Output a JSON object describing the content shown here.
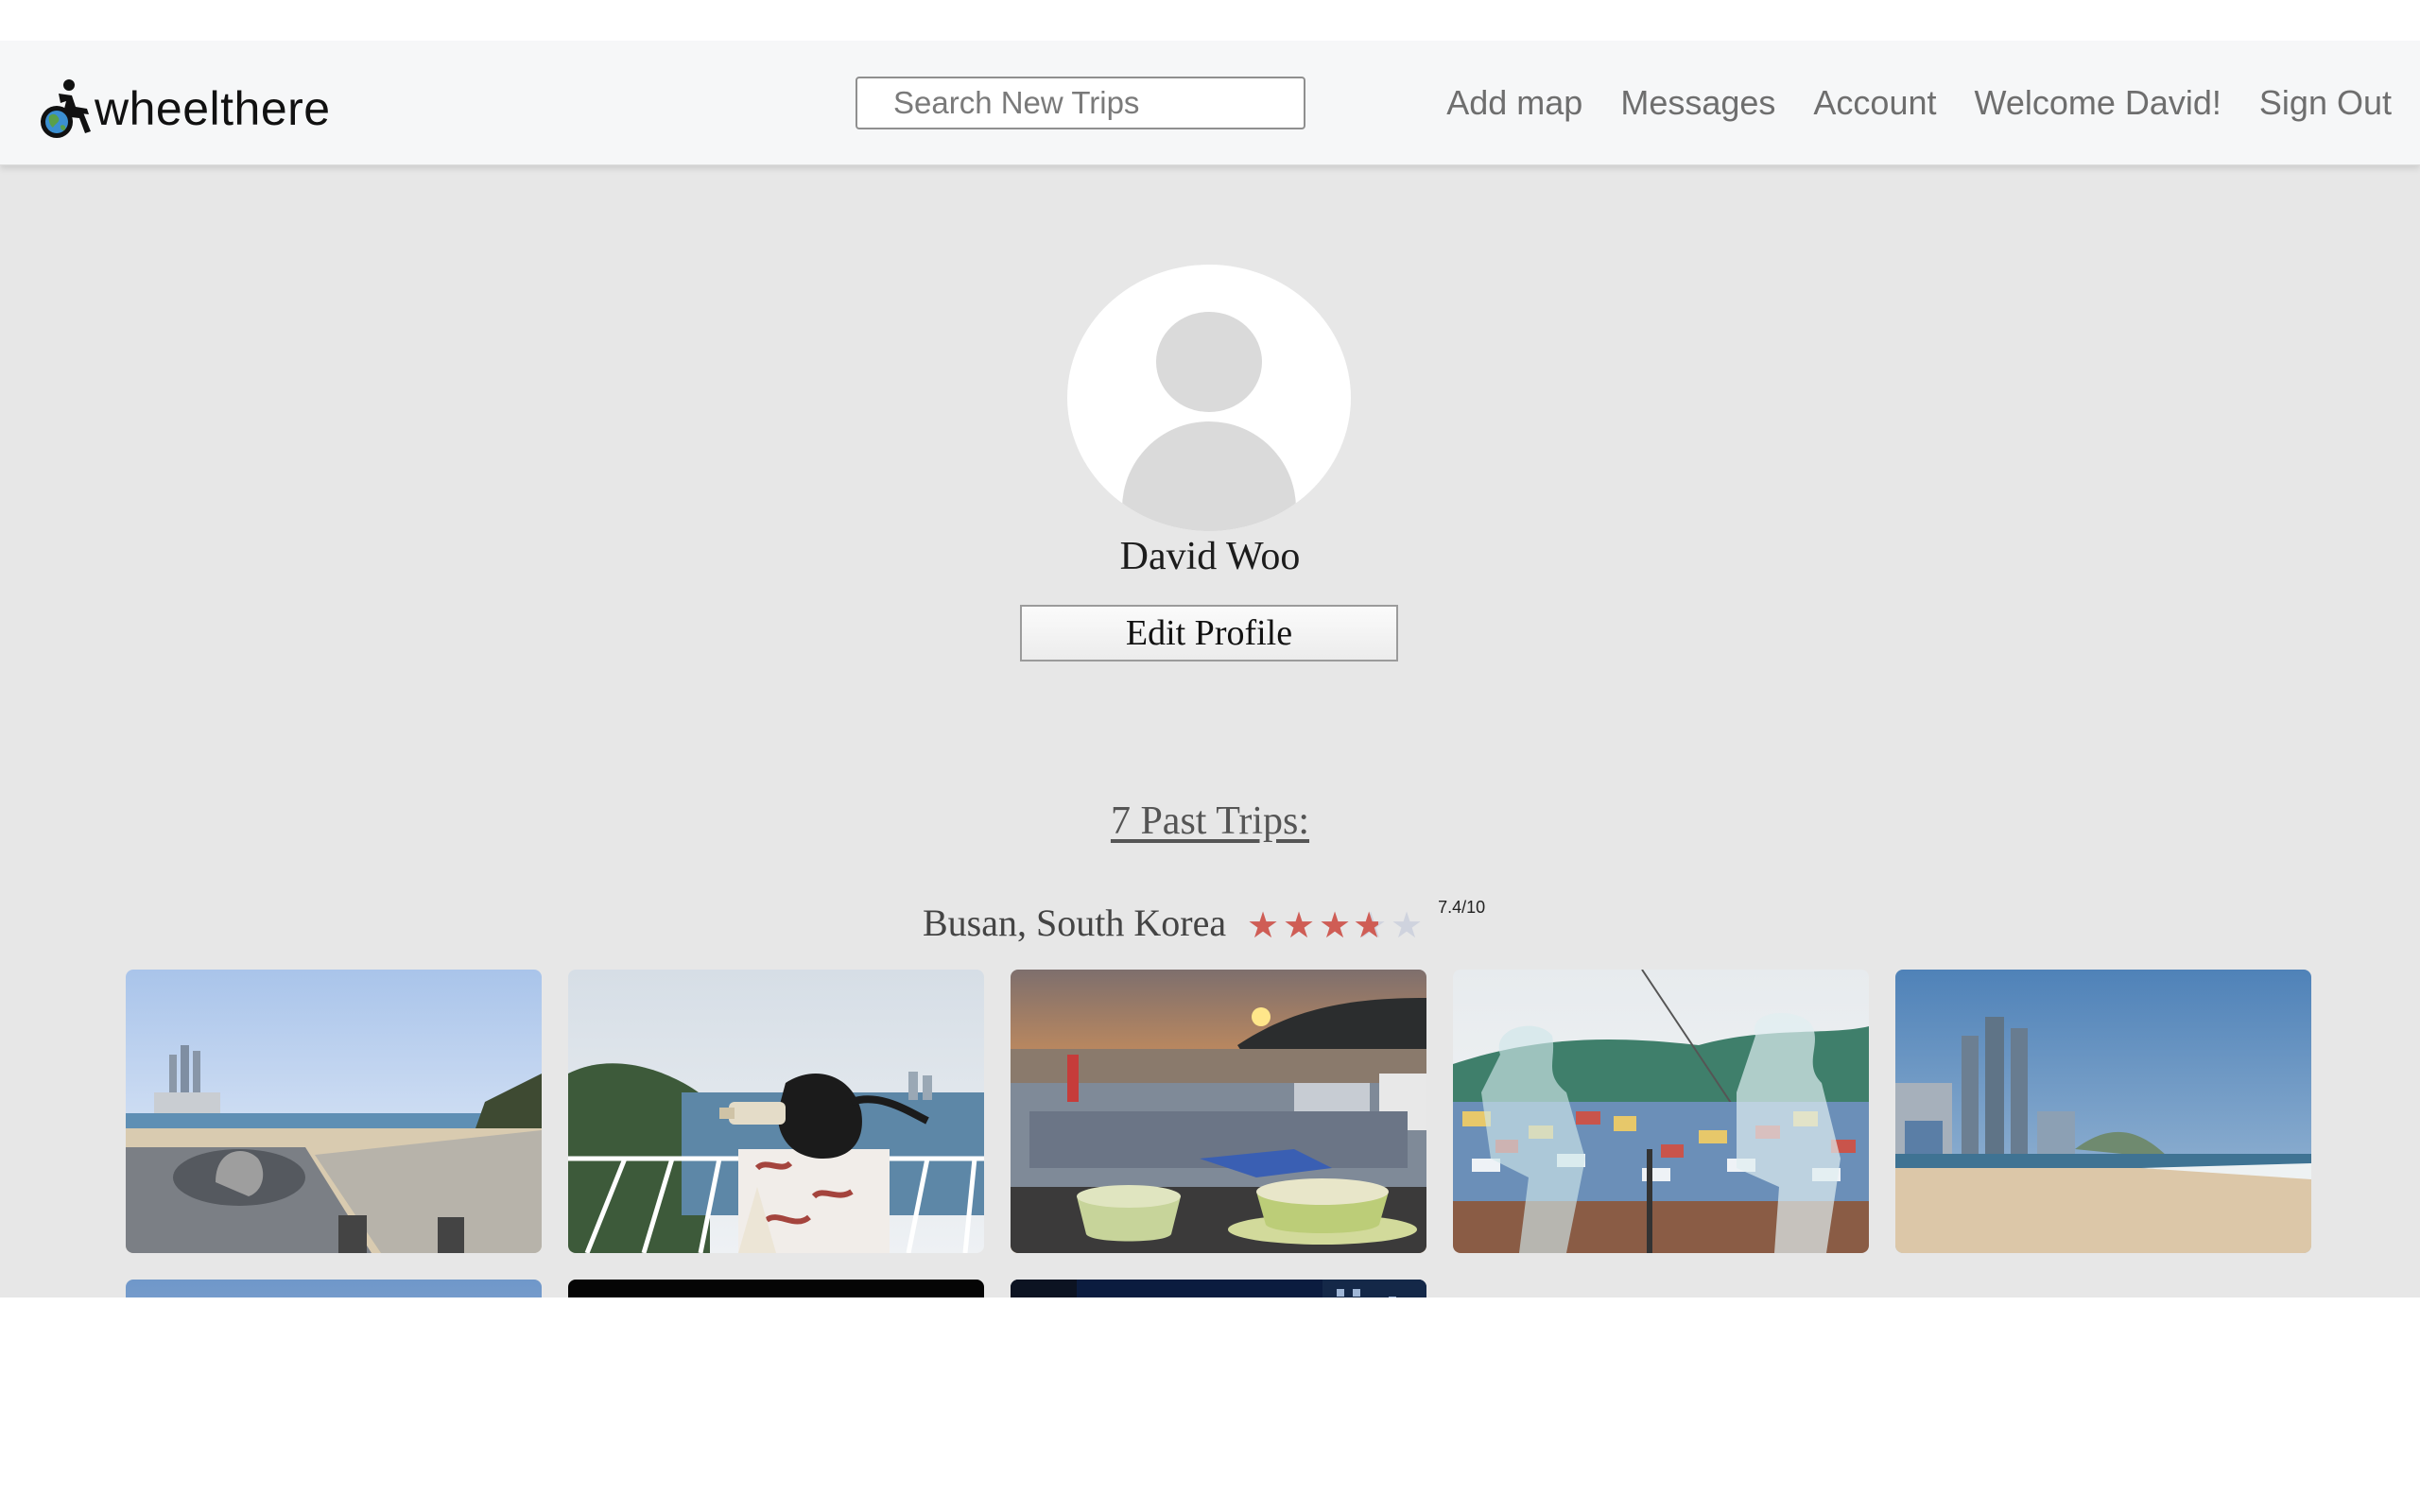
{
  "brand": {
    "name": "wheelthere",
    "logo_icon": "wheelchair-globe-icon"
  },
  "search": {
    "placeholder": "Search New Trips"
  },
  "nav": {
    "add_map": "Add map",
    "messages": "Messages",
    "account": "Account",
    "welcome": "Welcome David!",
    "sign_out": "Sign Out"
  },
  "profile": {
    "name": "David Woo",
    "edit_label": "Edit Profile",
    "avatar_icon": "user-silhouette-icon"
  },
  "trips": {
    "heading": "7 Past Trips:",
    "items": [
      {
        "title": "Busan, South Korea",
        "rating": "7.4/10",
        "stars_filled": 3.7,
        "stars_total": 5,
        "photos": [
          "beach-skyline-photo",
          "viewpoint-binoculars-photo",
          "sunset-harbor-coffee-photo",
          "village-sculpture-photo",
          "towers-beach-photo",
          "blue-sky-photo",
          "night-dark-photo",
          "night-city-photo"
        ]
      }
    ]
  },
  "colors": {
    "page_bg": "#e7e7e7",
    "navbar_bg": "#f6f7f8",
    "star_filled": "#cf5d55",
    "star_empty": "#cfd3de"
  }
}
